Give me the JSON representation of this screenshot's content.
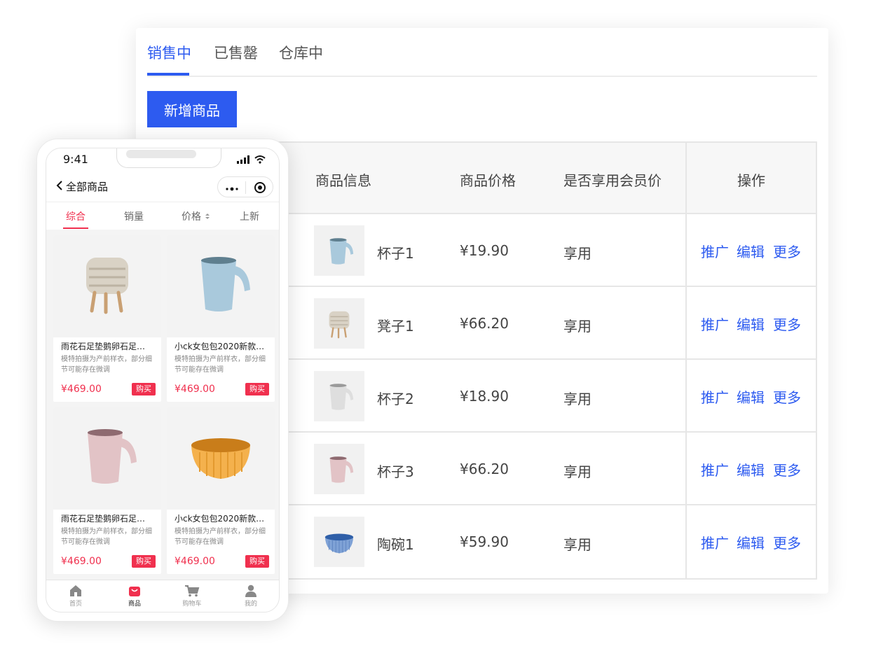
{
  "tabs": [
    "销售中",
    "已售罄",
    "仓库中"
  ],
  "add_button": "新增商品",
  "table": {
    "headers": [
      "商品信息",
      "商品价格",
      "是否享用会员价",
      "操作"
    ],
    "rows": [
      {
        "name": "杯子1",
        "price": "¥19.90",
        "member": "享用",
        "thumb": "cup-blue"
      },
      {
        "name": "凳子1",
        "price": "¥66.20",
        "member": "享用",
        "thumb": "stool"
      },
      {
        "name": "杯子2",
        "price": "¥18.90",
        "member": "享用",
        "thumb": "cup-grey"
      },
      {
        "name": "杯子3",
        "price": "¥66.20",
        "member": "享用",
        "thumb": "cup-pink"
      },
      {
        "name": "陶碗1",
        "price": "¥59.90",
        "member": "享用",
        "thumb": "bowl-blue"
      }
    ],
    "actions": [
      "推广",
      "编辑",
      "更多"
    ]
  },
  "phone": {
    "time": "9:41",
    "title": "全部商品",
    "sort_tabs": [
      "综合",
      "销量",
      "价格",
      "上新"
    ],
    "products": [
      {
        "name": "雨花石足垫鹅卵石足…",
        "desc": "模特拍摄为产前样衣，部分细节可能存在微调",
        "price": "¥469.00",
        "buy": "购买",
        "image": "stool"
      },
      {
        "name": "小ck女包包2020新款…",
        "desc": "模特拍摄为产前样衣，部分细节可能存在微调",
        "price": "¥469.00",
        "buy": "购买",
        "image": "cup-blue"
      },
      {
        "name": "雨花石足垫鹅卵石足…",
        "desc": "模特拍摄为产前样衣，部分细节可能存在微调",
        "price": "¥469.00",
        "buy": "购买",
        "image": "cup-pink"
      },
      {
        "name": "小ck女包包2020新款…",
        "desc": "模特拍摄为产前样衣，部分细节可能存在微调",
        "price": "¥469.00",
        "buy": "购买",
        "image": "bowl-orange"
      }
    ],
    "tabbar": [
      {
        "label": "首页",
        "icon": "home-icon"
      },
      {
        "label": "商品",
        "icon": "bag-icon"
      },
      {
        "label": "购物车",
        "icon": "cart-icon"
      },
      {
        "label": "我的",
        "icon": "user-icon"
      }
    ]
  },
  "colors": {
    "accent": "#2d5bf0",
    "sale_red": "#f0304e"
  }
}
